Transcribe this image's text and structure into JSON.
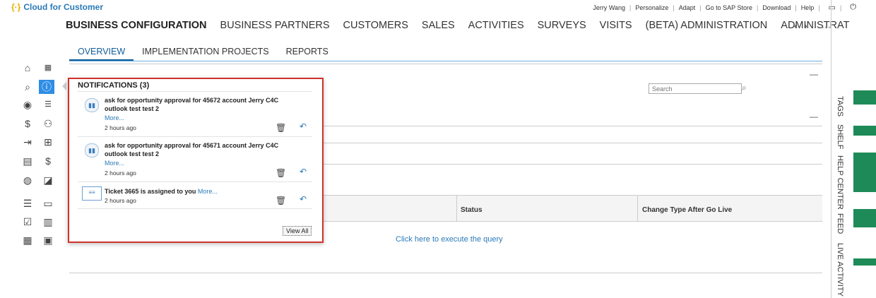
{
  "app": {
    "title": "Cloud for Customer",
    "logo_mark": "{·}"
  },
  "top_links": [
    "Jerry Wang",
    "Personalize",
    "Adapt",
    "Go to SAP Store",
    "Download",
    "Help"
  ],
  "main_nav": {
    "items": [
      "BUSINESS CONFIGURATION",
      "BUSINESS PARTNERS",
      "CUSTOMERS",
      "SALES",
      "ACTIVITIES",
      "SURVEYS",
      "VISITS",
      "(BETA) ADMINISTRATION",
      "ADMINISTRAT"
    ],
    "active_index": 0,
    "prev": "‹",
    "next": "›",
    "more": "◦◦◦"
  },
  "sub_nav": {
    "items": [
      "OVERVIEW",
      "IMPLEMENTATION PROJECTS",
      "REPORTS"
    ],
    "active_index": 0
  },
  "search": {
    "placeholder": "Search"
  },
  "table": {
    "columns": [
      "Status",
      "Change Type After Go Live"
    ]
  },
  "query_link": "Click here to execute the query",
  "right_tabs": [
    "TAGS",
    "SHELF",
    "HELP CENTER",
    "FEED",
    "LIVE ACTIVITY"
  ],
  "notifications": {
    "title": "NOTIFICATIONS (3)",
    "items": [
      {
        "text": "ask for opportunity approval for 45672 account Jerry C4C outlook test test 2",
        "more": "More...",
        "time": "2 hours ago",
        "icon": "approval-icon"
      },
      {
        "text": "ask for opportunity approval for 45671 account Jerry C4C outlook test test 2",
        "more": "More...",
        "time": "2 hours ago",
        "icon": "approval-icon"
      },
      {
        "text": "Ticket 3665 is assigned to you",
        "more": "More...",
        "time": "2 hours ago",
        "icon": "ticket-icon"
      }
    ],
    "view_all": "View All"
  },
  "colors": {
    "accent": "#2f8de4",
    "highlight_border": "#d0322b",
    "link": "#2a7ab8",
    "green": "#1e8a57"
  }
}
